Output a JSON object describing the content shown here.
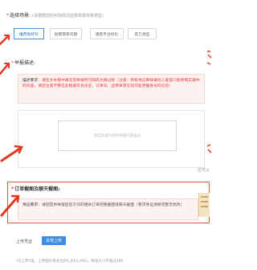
{
  "scene": {
    "title": "选择场景:",
    "hint": "(请根据您的实际情况选择举报场景类型)",
    "options": [
      "推荐他好价",
      "他钢需有问题",
      "语音平台好价",
      "其它类型"
    ]
  },
  "report_desc": {
    "title": "举报描述:",
    "guide_label": "描述要求",
    "guide_text": "请在文本框中填写您举报时可知的大概过程（注意：所有凭证审核被找人能提只能够照实填中的内容，请您注意不要在此框填写会员名、订单号、运费单等任何可能泄露身份的信息）",
    "textarea_placeholder": "请自动填写你的举报内容描述",
    "char_count": "还可以"
  },
  "screenshot": {
    "title": "订单截图及聊天截图:",
    "guide_label": "凭证要求",
    "guide_text": "请您提供举报后您方作的相关订单完整截图或聊天截图（要求凭证清晰完整无修改）"
  },
  "upload": {
    "label": "上传凭证",
    "button": "本地上传",
    "note": "(可上传5张，上传图片格式为JPG,JPEG,PNG，每张大小不超过2M)"
  },
  "colors": {
    "annotation_arrow": "#e0391e",
    "highlight_frame": "#e05a3a",
    "selected_option": "#4a90d9",
    "upload_button": "#3a8ee6"
  }
}
